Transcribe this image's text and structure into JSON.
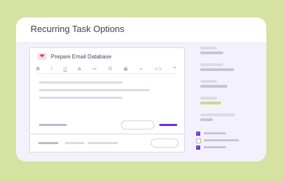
{
  "dialog": {
    "title": "Recurring Task Options"
  },
  "editor": {
    "task_name": "Prepare Email Database",
    "task_icon": "heart-icon",
    "toolbar": [
      {
        "name": "bold-icon",
        "glyph": "B"
      },
      {
        "name": "italic-icon",
        "glyph": "I"
      },
      {
        "name": "underline-icon",
        "glyph": "U"
      },
      {
        "name": "strikethrough-icon",
        "glyph": "S"
      },
      {
        "name": "ordered-list-icon",
        "glyph": "≔"
      },
      {
        "name": "bullet-list-icon",
        "glyph": "☰"
      },
      {
        "name": "image-icon",
        "glyph": "▣"
      },
      {
        "name": "link-icon",
        "glyph": "∞"
      },
      {
        "name": "code-icon",
        "glyph": "<>"
      },
      {
        "name": "quote-icon",
        "glyph": "❞"
      }
    ]
  },
  "sidebar": {
    "checkboxes": [
      {
        "checked": true,
        "mark": "✓"
      },
      {
        "checked": false,
        "mark": ""
      },
      {
        "checked": true,
        "mark": "✓"
      }
    ]
  },
  "colors": {
    "accent": "#6a2ee0",
    "highlight": "#c8dc8a",
    "background": "#d5e2a2"
  }
}
